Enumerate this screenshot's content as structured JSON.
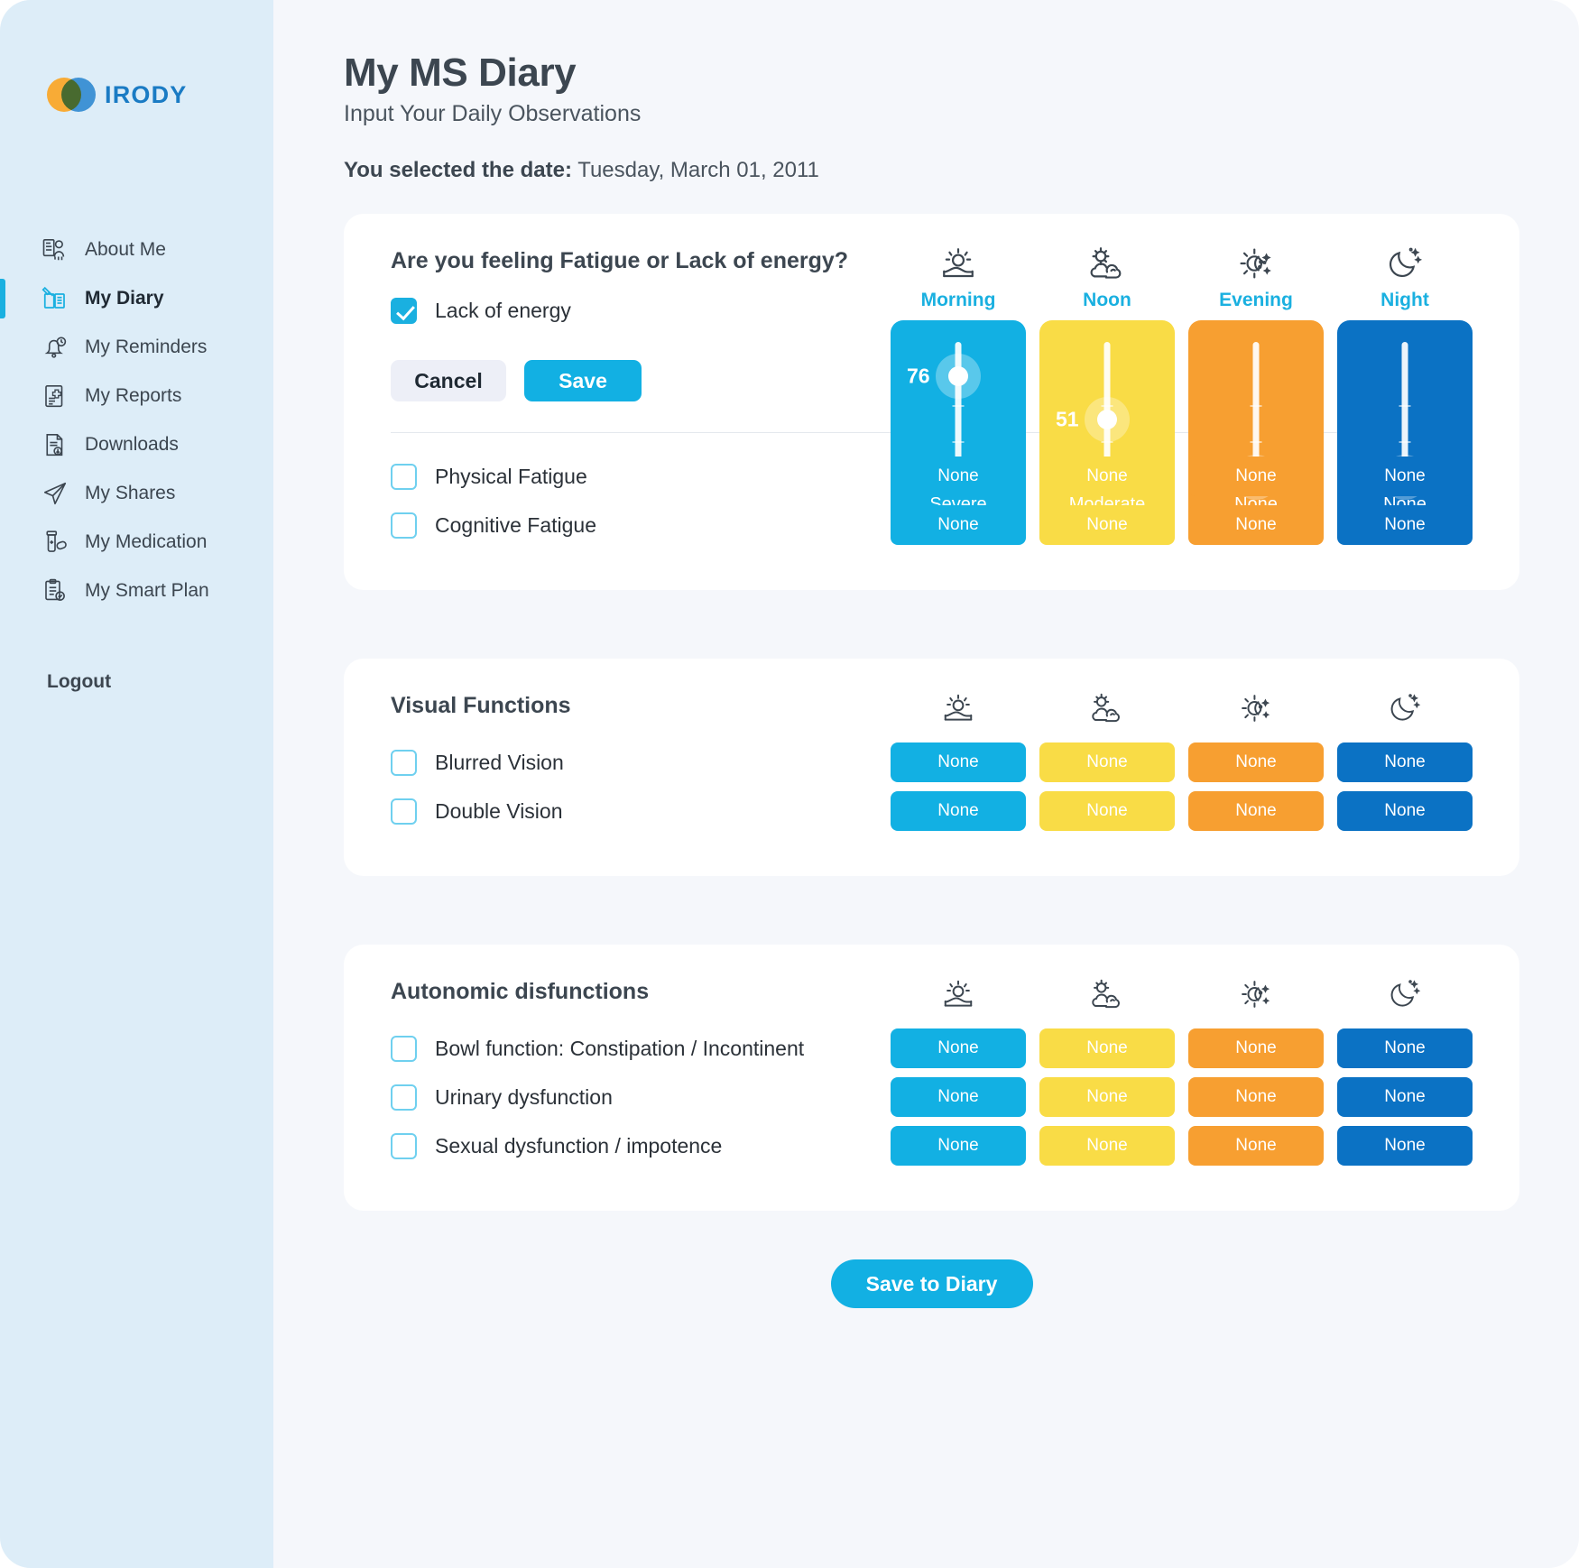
{
  "brand": {
    "name": "IRODY"
  },
  "sidebar": {
    "items": [
      {
        "label": "About Me",
        "icon": "person-card-icon",
        "active": false
      },
      {
        "label": "My Diary",
        "icon": "diary-pencil-icon",
        "active": true
      },
      {
        "label": "My Reminders",
        "icon": "bell-clock-icon",
        "active": false
      },
      {
        "label": "My Reports",
        "icon": "report-medical-icon",
        "active": false
      },
      {
        "label": "Downloads",
        "icon": "document-download-icon",
        "active": false
      },
      {
        "label": "My Shares",
        "icon": "paper-plane-icon",
        "active": false
      },
      {
        "label": "My Medication",
        "icon": "pill-bottle-icon",
        "active": false
      },
      {
        "label": "My Smart Plan",
        "icon": "clipboard-plan-icon",
        "active": false
      }
    ],
    "logout_label": "Logout"
  },
  "header": {
    "title": "My MS Diary",
    "subtitle": "Input Your Daily Observations",
    "date_label": "You selected the date:",
    "date_value": "Tuesday, March 01, 2011"
  },
  "times": [
    {
      "label": "Morning",
      "icon": "sunrise-icon"
    },
    {
      "label": "Noon",
      "icon": "sun-cloud-icon"
    },
    {
      "label": "Evening",
      "icon": "sun-moon-icon"
    },
    {
      "label": "Night",
      "icon": "moon-stars-icon"
    }
  ],
  "colors": {
    "morning": "#12b0e3",
    "noon": "#f9dc46",
    "evening": "#f79f31",
    "night": "#0b72c4",
    "accent": "#1ab0e0",
    "sidebar_bg": "#ddedf8",
    "page_bg": "#f5f7fb"
  },
  "fatigue_card": {
    "question": "Are you feeling Fatigue or Lack of energy?",
    "main_checkbox": {
      "label": "Lack of energy",
      "checked": true
    },
    "sliders": [
      {
        "time": "Morning",
        "value": "76",
        "severity": "Severe",
        "percent": 76
      },
      {
        "time": "Noon",
        "value": "51",
        "severity": "Moderate",
        "percent": 51
      },
      {
        "time": "Evening",
        "value": "0",
        "severity": "None",
        "percent": 0
      },
      {
        "time": "Night",
        "value": "0",
        "severity": "None",
        "percent": 0
      }
    ],
    "buttons": {
      "cancel": "Cancel",
      "save": "Save"
    },
    "sub_rows": [
      {
        "label": "Physical Fatigue",
        "checked": false,
        "values": [
          "None",
          "None",
          "None",
          "None"
        ]
      },
      {
        "label": "Cognitive Fatigue",
        "checked": false,
        "values": [
          "None",
          "None",
          "None",
          "None"
        ]
      }
    ]
  },
  "visual_card": {
    "title": "Visual Functions",
    "rows": [
      {
        "label": "Blurred Vision",
        "checked": false,
        "values": [
          "None",
          "None",
          "None",
          "None"
        ]
      },
      {
        "label": "Double Vision",
        "checked": false,
        "values": [
          "None",
          "None",
          "None",
          "None"
        ]
      }
    ]
  },
  "autonomic_card": {
    "title": "Autonomic disfunctions",
    "rows": [
      {
        "label": "Bowl function: Constipation / Incontinent",
        "checked": false,
        "values": [
          "None",
          "None",
          "None",
          "None"
        ]
      },
      {
        "label": "Urinary dysfunction",
        "checked": false,
        "values": [
          "None",
          "None",
          "None",
          "None"
        ]
      },
      {
        "label": "Sexual dysfunction / impotence",
        "checked": false,
        "values": [
          "None",
          "None",
          "None",
          "None"
        ]
      }
    ]
  },
  "footer": {
    "save_to_diary": "Save to Diary"
  }
}
